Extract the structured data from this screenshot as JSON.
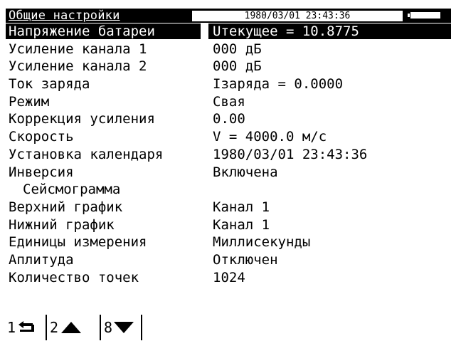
{
  "header": {
    "title": "Общие настройки",
    "datetime": "1980/03/01  23:43:36"
  },
  "settings": [
    {
      "label": "Напряжение батареи",
      "value": "Uтекущее = 10.8775"
    },
    {
      "label": "Усиление канала 1",
      "value": "000 дБ"
    },
    {
      "label": "Усиление канала 2",
      "value": "000 дБ"
    },
    {
      "label": "Ток заряда",
      "value": "Iзаряда = 0.0000"
    },
    {
      "label": "Режим",
      "value": "Свая"
    },
    {
      "label": "Коррекция усиления",
      "value": "0.00"
    },
    {
      "label": "Скорость",
      "value": "V = 4000.0 м/с"
    },
    {
      "label": "Установка календаря",
      "value": "1980/03/01 23:43:36"
    },
    {
      "label": "Инверсия",
      "value": "Включена"
    },
    {
      "label": "Сейсмограмма",
      "value": ""
    },
    {
      "label": "Верхний график",
      "value": "Канал 1"
    },
    {
      "label": "Нижний график",
      "value": "Канал 1"
    },
    {
      "label": "Единицы измерения",
      "value": "Миллисекунды"
    },
    {
      "label": "Аплитуда",
      "value": "Отключен"
    },
    {
      "label": "Количество точек",
      "value": "1024"
    }
  ],
  "softkeys": [
    {
      "num": "1",
      "icon": "return-icon"
    },
    {
      "num": "2",
      "icon": "arrow-up-icon"
    },
    {
      "num": "8",
      "icon": "arrow-down-icon"
    }
  ]
}
